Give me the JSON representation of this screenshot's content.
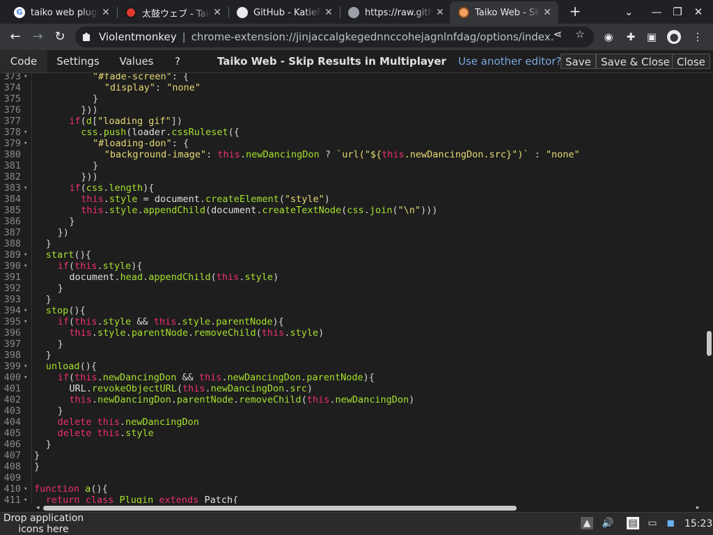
{
  "browser": {
    "tabs": [
      {
        "title": "taiko web plugin",
        "icon": "google-icon",
        "active": false
      },
      {
        "title": "太鼓ウェブ - Taiko",
        "icon": "taiko-icon",
        "active": false
      },
      {
        "title": "GitHub - KatieFrogs",
        "icon": "github-icon",
        "active": false
      },
      {
        "title": "https://raw.githubusercontent.com",
        "icon": "globe-icon",
        "active": false
      },
      {
        "title": "Taiko Web - Skip Results",
        "icon": "violentmonkey-icon",
        "active": true
      }
    ],
    "address": {
      "extension_name": "Violentmonkey",
      "url": "chrome-extension://jinjaccalgkegednnccohejagnlnfdag/options/index.html"
    }
  },
  "editor": {
    "tabs": [
      "Code",
      "Settings",
      "Values",
      "?"
    ],
    "script_title": "Taiko Web - Skip Results in Multiplayer",
    "other_editor_link": "Use another editor?",
    "buttons": {
      "save": "Save",
      "save_close": "Save & Close",
      "close": "Close"
    }
  },
  "code_lines": [
    {
      "n": "373",
      "fold": true,
      "indent": 10,
      "tokens": [
        [
          "s",
          "\"#fade-screen\""
        ],
        [
          "p",
          ": {"
        ]
      ]
    },
    {
      "n": "374",
      "fold": false,
      "indent": 12,
      "tokens": [
        [
          "s",
          "\"display\""
        ],
        [
          "p",
          ": "
        ],
        [
          "s",
          "\"none\""
        ]
      ]
    },
    {
      "n": "375",
      "fold": false,
      "indent": 10,
      "tokens": [
        [
          "p",
          "}"
        ]
      ]
    },
    {
      "n": "376",
      "fold": false,
      "indent": 8,
      "tokens": [
        [
          "p",
          "}))"
        ]
      ]
    },
    {
      "n": "377",
      "fold": false,
      "indent": 6,
      "tokens": [
        [
          "k",
          "if"
        ],
        [
          "p",
          "("
        ],
        [
          "f",
          "d"
        ],
        [
          "p",
          "["
        ],
        [
          "s",
          "\"loading gif\""
        ],
        [
          "p",
          "])"
        ]
      ]
    },
    {
      "n": "378",
      "fold": true,
      "indent": 8,
      "tokens": [
        [
          "f",
          "css"
        ],
        [
          "p",
          "."
        ],
        [
          "f",
          "push"
        ],
        [
          "p",
          "("
        ],
        [
          "v",
          "loader"
        ],
        [
          "p",
          "."
        ],
        [
          "f",
          "cssRuleset"
        ],
        [
          "p",
          "({"
        ]
      ]
    },
    {
      "n": "379",
      "fold": true,
      "indent": 10,
      "tokens": [
        [
          "s",
          "\"#loading-don\""
        ],
        [
          "p",
          ": {"
        ]
      ]
    },
    {
      "n": "380",
      "fold": false,
      "indent": 12,
      "tokens": [
        [
          "s",
          "\"background-image\""
        ],
        [
          "p",
          ": "
        ],
        [
          "k",
          "this"
        ],
        [
          "p",
          "."
        ],
        [
          "f",
          "newDancingDon"
        ],
        [
          "p",
          " ? "
        ],
        [
          "s",
          "`url(\"${"
        ],
        [
          "k",
          "this"
        ],
        [
          "s",
          ".newDancingDon.src}\")`"
        ],
        [
          "p",
          " : "
        ],
        [
          "s",
          "\"none\""
        ]
      ]
    },
    {
      "n": "381",
      "fold": false,
      "indent": 10,
      "tokens": [
        [
          "p",
          "}"
        ]
      ]
    },
    {
      "n": "382",
      "fold": false,
      "indent": 8,
      "tokens": [
        [
          "p",
          "}))"
        ]
      ]
    },
    {
      "n": "383",
      "fold": true,
      "indent": 6,
      "tokens": [
        [
          "k",
          "if"
        ],
        [
          "p",
          "("
        ],
        [
          "f",
          "css"
        ],
        [
          "p",
          "."
        ],
        [
          "f",
          "length"
        ],
        [
          "p",
          "){"
        ]
      ]
    },
    {
      "n": "384",
      "fold": false,
      "indent": 8,
      "tokens": [
        [
          "k",
          "this"
        ],
        [
          "p",
          "."
        ],
        [
          "f",
          "style"
        ],
        [
          "p",
          " = "
        ],
        [
          "v",
          "document"
        ],
        [
          "p",
          "."
        ],
        [
          "f",
          "createElement"
        ],
        [
          "p",
          "("
        ],
        [
          "s",
          "\"style\""
        ],
        [
          "p",
          ")"
        ]
      ]
    },
    {
      "n": "385",
      "fold": false,
      "indent": 8,
      "tokens": [
        [
          "k",
          "this"
        ],
        [
          "p",
          "."
        ],
        [
          "f",
          "style"
        ],
        [
          "p",
          "."
        ],
        [
          "f",
          "appendChild"
        ],
        [
          "p",
          "("
        ],
        [
          "v",
          "document"
        ],
        [
          "p",
          "."
        ],
        [
          "f",
          "createTextNode"
        ],
        [
          "p",
          "("
        ],
        [
          "f",
          "css"
        ],
        [
          "p",
          "."
        ],
        [
          "f",
          "join"
        ],
        [
          "p",
          "("
        ],
        [
          "s",
          "\"\\n\""
        ],
        [
          "p",
          ")))"
        ]
      ]
    },
    {
      "n": "386",
      "fold": false,
      "indent": 6,
      "tokens": [
        [
          "p",
          "}"
        ]
      ]
    },
    {
      "n": "387",
      "fold": false,
      "indent": 4,
      "tokens": [
        [
          "p",
          "})"
        ]
      ]
    },
    {
      "n": "388",
      "fold": false,
      "indent": 2,
      "tokens": [
        [
          "p",
          "}"
        ]
      ]
    },
    {
      "n": "389",
      "fold": true,
      "indent": 2,
      "tokens": [
        [
          "f",
          "start"
        ],
        [
          "p",
          "(){"
        ]
      ]
    },
    {
      "n": "390",
      "fold": true,
      "indent": 4,
      "tokens": [
        [
          "k",
          "if"
        ],
        [
          "p",
          "("
        ],
        [
          "k",
          "this"
        ],
        [
          "p",
          "."
        ],
        [
          "f",
          "style"
        ],
        [
          "p",
          "){"
        ]
      ]
    },
    {
      "n": "391",
      "fold": false,
      "indent": 6,
      "tokens": [
        [
          "v",
          "document"
        ],
        [
          "p",
          "."
        ],
        [
          "f",
          "head"
        ],
        [
          "p",
          "."
        ],
        [
          "f",
          "appendChild"
        ],
        [
          "p",
          "("
        ],
        [
          "k",
          "this"
        ],
        [
          "p",
          "."
        ],
        [
          "f",
          "style"
        ],
        [
          "p",
          ")"
        ]
      ]
    },
    {
      "n": "392",
      "fold": false,
      "indent": 4,
      "tokens": [
        [
          "p",
          "}"
        ]
      ]
    },
    {
      "n": "393",
      "fold": false,
      "indent": 2,
      "tokens": [
        [
          "p",
          "}"
        ]
      ]
    },
    {
      "n": "394",
      "fold": true,
      "indent": 2,
      "tokens": [
        [
          "f",
          "stop"
        ],
        [
          "p",
          "(){"
        ]
      ]
    },
    {
      "n": "395",
      "fold": true,
      "indent": 4,
      "tokens": [
        [
          "k",
          "if"
        ],
        [
          "p",
          "("
        ],
        [
          "k",
          "this"
        ],
        [
          "p",
          "."
        ],
        [
          "f",
          "style"
        ],
        [
          "p",
          " && "
        ],
        [
          "k",
          "this"
        ],
        [
          "p",
          "."
        ],
        [
          "f",
          "style"
        ],
        [
          "p",
          "."
        ],
        [
          "f",
          "parentNode"
        ],
        [
          "p",
          "){"
        ]
      ]
    },
    {
      "n": "396",
      "fold": false,
      "indent": 6,
      "tokens": [
        [
          "k",
          "this"
        ],
        [
          "p",
          "."
        ],
        [
          "f",
          "style"
        ],
        [
          "p",
          "."
        ],
        [
          "f",
          "parentNode"
        ],
        [
          "p",
          "."
        ],
        [
          "f",
          "removeChild"
        ],
        [
          "p",
          "("
        ],
        [
          "k",
          "this"
        ],
        [
          "p",
          "."
        ],
        [
          "f",
          "style"
        ],
        [
          "p",
          ")"
        ]
      ]
    },
    {
      "n": "397",
      "fold": false,
      "indent": 4,
      "tokens": [
        [
          "p",
          "}"
        ]
      ]
    },
    {
      "n": "398",
      "fold": false,
      "indent": 2,
      "tokens": [
        [
          "p",
          "}"
        ]
      ]
    },
    {
      "n": "399",
      "fold": true,
      "indent": 2,
      "tokens": [
        [
          "f",
          "unload"
        ],
        [
          "p",
          "(){"
        ]
      ]
    },
    {
      "n": "400",
      "fold": true,
      "indent": 4,
      "tokens": [
        [
          "k",
          "if"
        ],
        [
          "p",
          "("
        ],
        [
          "k",
          "this"
        ],
        [
          "p",
          "."
        ],
        [
          "f",
          "newDancingDon"
        ],
        [
          "p",
          " && "
        ],
        [
          "k",
          "this"
        ],
        [
          "p",
          "."
        ],
        [
          "f",
          "newDancingDon"
        ],
        [
          "p",
          "."
        ],
        [
          "f",
          "parentNode"
        ],
        [
          "p",
          "){"
        ]
      ]
    },
    {
      "n": "401",
      "fold": false,
      "indent": 6,
      "tokens": [
        [
          "v",
          "URL"
        ],
        [
          "p",
          "."
        ],
        [
          "f",
          "revokeObjectURL"
        ],
        [
          "p",
          "("
        ],
        [
          "k",
          "this"
        ],
        [
          "p",
          "."
        ],
        [
          "f",
          "newDancingDon"
        ],
        [
          "p",
          "."
        ],
        [
          "f",
          "src"
        ],
        [
          "p",
          ")"
        ]
      ]
    },
    {
      "n": "402",
      "fold": false,
      "indent": 6,
      "tokens": [
        [
          "k",
          "this"
        ],
        [
          "p",
          "."
        ],
        [
          "f",
          "newDancingDon"
        ],
        [
          "p",
          "."
        ],
        [
          "f",
          "parentNode"
        ],
        [
          "p",
          "."
        ],
        [
          "f",
          "removeChild"
        ],
        [
          "p",
          "("
        ],
        [
          "k",
          "this"
        ],
        [
          "p",
          "."
        ],
        [
          "f",
          "newDancingDon"
        ],
        [
          "p",
          ")"
        ]
      ]
    },
    {
      "n": "403",
      "fold": false,
      "indent": 4,
      "tokens": [
        [
          "p",
          "}"
        ]
      ]
    },
    {
      "n": "404",
      "fold": false,
      "indent": 4,
      "tokens": [
        [
          "k",
          "delete"
        ],
        [
          "p",
          " "
        ],
        [
          "k",
          "this"
        ],
        [
          "p",
          "."
        ],
        [
          "f",
          "newDancingDon"
        ]
      ]
    },
    {
      "n": "405",
      "fold": false,
      "indent": 4,
      "tokens": [
        [
          "k",
          "delete"
        ],
        [
          "p",
          " "
        ],
        [
          "k",
          "this"
        ],
        [
          "p",
          "."
        ],
        [
          "f",
          "style"
        ]
      ]
    },
    {
      "n": "406",
      "fold": false,
      "indent": 2,
      "tokens": [
        [
          "p",
          "}"
        ]
      ]
    },
    {
      "n": "407",
      "fold": false,
      "indent": 0,
      "tokens": [
        [
          "p",
          "}"
        ]
      ]
    },
    {
      "n": "408",
      "fold": false,
      "indent": 0,
      "tokens": [
        [
          "p",
          "}"
        ]
      ]
    },
    {
      "n": "409",
      "fold": false,
      "indent": 0,
      "tokens": []
    },
    {
      "n": "410",
      "fold": true,
      "indent": 0,
      "tokens": [
        [
          "k",
          "function"
        ],
        [
          "p",
          " "
        ],
        [
          "f",
          "a"
        ],
        [
          "p",
          "(){"
        ]
      ]
    },
    {
      "n": "411",
      "fold": true,
      "indent": 2,
      "tokens": [
        [
          "k",
          "return"
        ],
        [
          "p",
          " "
        ],
        [
          "k",
          "class"
        ],
        [
          "p",
          " "
        ],
        [
          "f",
          "Plugin"
        ],
        [
          "p",
          " "
        ],
        [
          "k",
          "extends"
        ],
        [
          "p",
          " "
        ],
        [
          "v",
          "Patch"
        ],
        [
          "p",
          "{"
        ]
      ]
    },
    {
      "n": "412",
      "fold": false,
      "indent": 0,
      "tokens": []
    }
  ],
  "taskbar": {
    "drop_hint": "Drop application icons here",
    "clock": "15:23"
  },
  "colors": {
    "keyword": "#f0306a",
    "string": "#e6db74",
    "identifier": "#a6e22e",
    "link": "#7aa7e0"
  }
}
